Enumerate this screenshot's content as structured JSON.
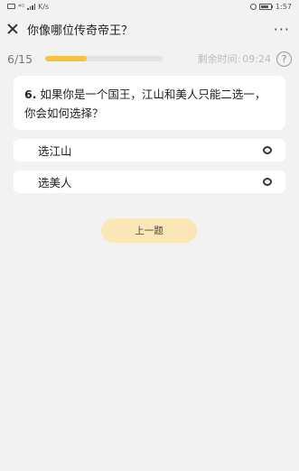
{
  "status": {
    "signal_text": "⁴ᴳ",
    "speed_text": "K/s",
    "time": "1:57"
  },
  "header": {
    "title": "你像哪位传奇帝王？",
    "more_label": "···"
  },
  "progress": {
    "count_text": "6/15",
    "fraction": 0.35,
    "timer_label": "剩余时间:",
    "timer_value": "09:24",
    "help_label": "?"
  },
  "question": {
    "number": "6.",
    "text": " 如果你是一个国王，江山和美人只能二选一，你会如何选择？"
  },
  "options": [
    {
      "label": "选江山"
    },
    {
      "label": "选美人"
    }
  ],
  "actions": {
    "prev_label": "上一题"
  },
  "colors": {
    "accent": "#f6c23c",
    "button_bg": "#fbe7b6",
    "page_bg": "#f2f2f2"
  }
}
